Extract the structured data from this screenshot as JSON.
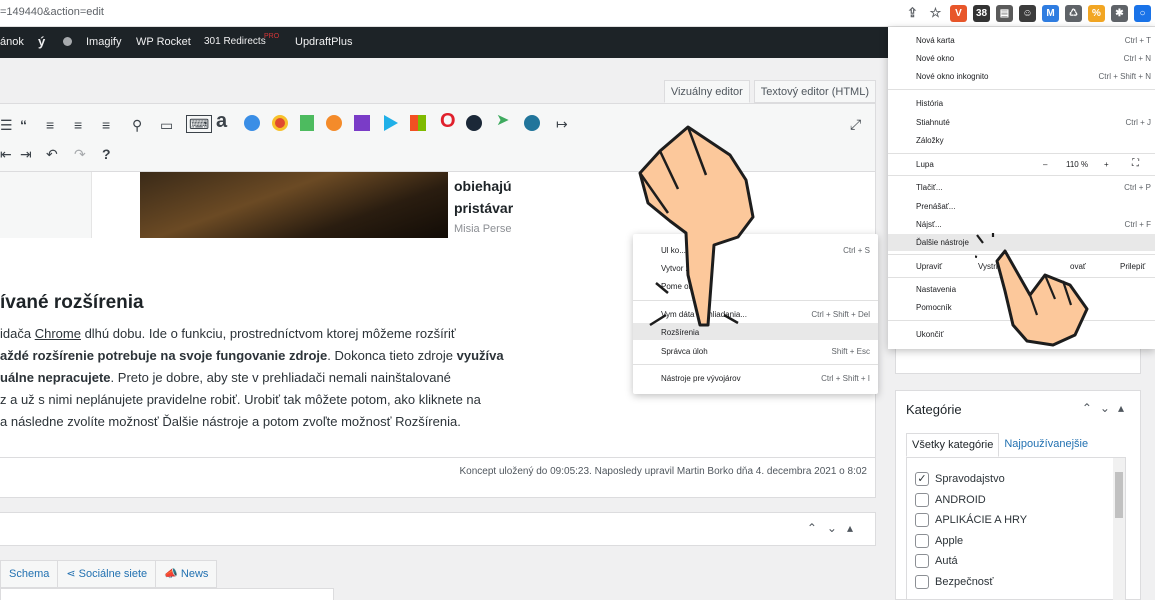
{
  "browser": {
    "url": "=149440&action=edit",
    "extensions": [
      {
        "name": "share-icon",
        "glyph": "⇪",
        "color": "#5f6368"
      },
      {
        "name": "bookmark-star-icon",
        "glyph": "☆",
        "color": "#5f6368"
      },
      {
        "name": "vpn-extension-icon",
        "glyph": "V",
        "color": "#e8562a"
      },
      {
        "name": "calendar-extension-icon",
        "glyph": "38",
        "color": "#333333"
      },
      {
        "name": "notes-extension-icon",
        "glyph": "▤",
        "color": "#5a5a5a"
      },
      {
        "name": "alien-extension-icon",
        "glyph": "☺",
        "color": "#3c3c3c"
      },
      {
        "name": "mail-extension-icon",
        "glyph": "M",
        "color": "#2f7de1"
      },
      {
        "name": "recycle-extension-icon",
        "glyph": "♺",
        "color": "#5f6368"
      },
      {
        "name": "coupon-extension-icon",
        "glyph": "%",
        "color": "#f2a623"
      },
      {
        "name": "puzzle-extensions-icon",
        "glyph": "✱",
        "color": "#5f6368"
      },
      {
        "name": "profile-icon",
        "glyph": "○",
        "color": "#1a73e8"
      }
    ]
  },
  "adminbar": {
    "item1": "ánok",
    "item2": "Imagify",
    "item3": "WP Rocket",
    "item4": "301 Redirects",
    "item4_badge": "PRO",
    "item5": "UpdraftPlus"
  },
  "editor": {
    "tab_visual": "Vizuálny editor",
    "tab_text": "Textový editor (HTML)",
    "side_title_1": "obiehajú",
    "side_title_2": "pristávar",
    "side_meta": "Misia Perse",
    "heading": "ívané rozšírenia",
    "p1_a": "idača ",
    "p1_link": "Chrome",
    "p1_b": " dlhú dobu. Ide o funkciu, prostredníctvom ktorej môžeme rozšíriť",
    "p2_bold": "aždé rozšírenie potrebuje na svoje fungovanie zdroje",
    "p2_b": ". Dokonca tieto zdroje ",
    "p2_bold2": "využíva",
    "p3_bold": "uálne nepracujete",
    "p3_b": ". Preto je dobre, aby ste v prehliadači nemali nainštalované",
    "p4": "z a už s nimi neplánujete pravidelne robiť. Urobiť tak môžete potom, ako kliknete na",
    "p5": "a následne zvolíte možnosť Ďalšie nástroje a potom zvoľte možnosť Rozšírenia.",
    "status": "Koncept uložený do 09:05:23. Naposledy upravil Martin Borko dňa 4. decembra 2021 o 8:02"
  },
  "seo_tabs": [
    "Schema",
    "Sociálne siete",
    "News"
  ],
  "categories": {
    "title": "Kategórie",
    "tab_all": "Všetky kategórie",
    "tab_popular": "Najpoužívanejšie",
    "items": [
      {
        "label": "Spravodajstvo",
        "checked": "✓"
      },
      {
        "label": "ANDROID",
        "checked": ""
      },
      {
        "label": "APLIKÁCIE A HRY",
        "checked": ""
      },
      {
        "label": "Apple",
        "checked": ""
      },
      {
        "label": "Autá",
        "checked": ""
      },
      {
        "label": "Bezpečnosť",
        "checked": ""
      }
    ]
  },
  "chrome_menu": {
    "new_tab": "Nová karta",
    "new_tab_sc": "Ctrl + T",
    "new_window": "Nové okno",
    "new_window_sc": "Ctrl + N",
    "incognito": "Nové okno inkognito",
    "incognito_sc": "Ctrl + Shift + N",
    "history": "História",
    "downloads": "Stiahnuté",
    "downloads_sc": "Ctrl + J",
    "bookmarks": "Záložky",
    "zoom": "Lupa",
    "zoom_minus": "–",
    "zoom_value": "110 %",
    "zoom_plus": "+",
    "print": "Tlačiť...",
    "print_sc": "Ctrl + P",
    "cast": "Prenášať...",
    "find": "Nájsť...",
    "find_sc": "Ctrl + F",
    "more_tools": "Ďalšie nástroje",
    "edit": "Upraviť",
    "cut": "Vystrih",
    "copy": "ovať",
    "paste": "Prilepiť",
    "settings": "Nastavenia",
    "help": "Pomocník",
    "exit": "Ukončiť"
  },
  "sub_menu": {
    "save": "Ul                 ko...",
    "save_sc": "Ctrl + S",
    "create": "Vytvor          z...",
    "name_window": "Pome         okno...",
    "clear": "Vym          dáta prehliadania...",
    "clear_sc": "Ctrl + Shift + Del",
    "extensions": "Rozšírenia",
    "task_manager": "Správca úloh",
    "task_manager_sc": "Shift + Esc",
    "devtools": "Nástroje pre vývojárov",
    "devtools_sc": "Ctrl + Shift + I"
  }
}
